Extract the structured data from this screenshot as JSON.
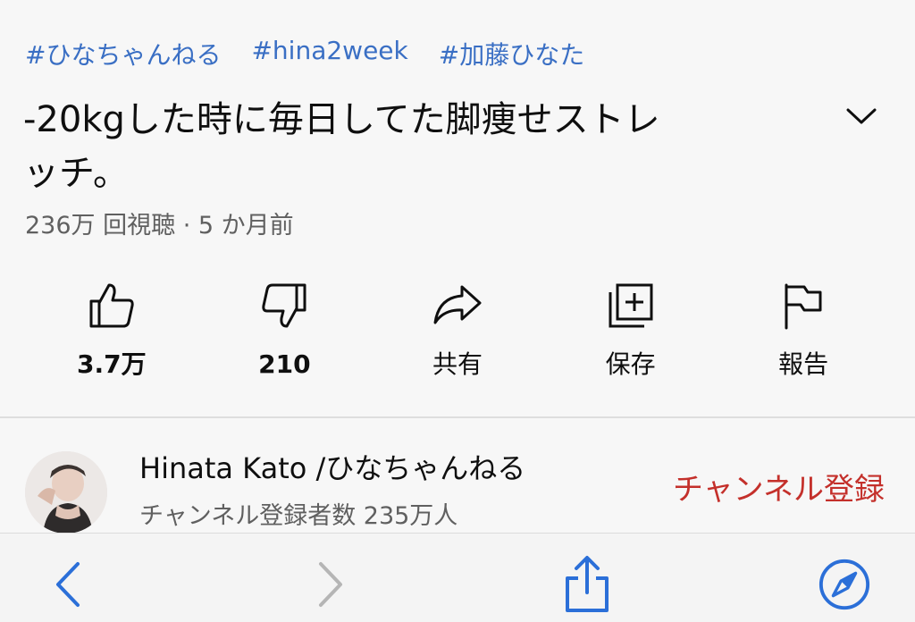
{
  "tags": [
    "#ひなちゃんねる",
    "#hina2week",
    "#加藤ひなた"
  ],
  "video": {
    "title_line1": "-20kgした時に毎日してた脚痩せストレ",
    "title_line2": "ッチ。",
    "meta": "236万 回視聴 · 5 か月前"
  },
  "actions": {
    "like": "3.7万",
    "dislike": "210",
    "share": "共有",
    "save": "保存",
    "report": "報告"
  },
  "channel": {
    "name": "Hinata Kato /ひなちゃんねる",
    "subscribers": "チャンネル登録者数 235万人",
    "subscribe_label": "チャンネル登録"
  },
  "colors": {
    "link": "#3a6fc4",
    "subscribe": "#c4302b",
    "safari_blue": "#2b6fd8",
    "disabled": "#b5b5b5"
  },
  "icons": {
    "expand": "chevron-down-icon",
    "like": "thumbs-up-icon",
    "dislike": "thumbs-down-icon",
    "share": "share-arrow-icon",
    "save": "add-to-playlist-icon",
    "report": "flag-icon",
    "back": "chevron-left-icon",
    "forward": "chevron-right-icon",
    "share_sheet": "share-sheet-icon",
    "compass": "compass-icon"
  }
}
